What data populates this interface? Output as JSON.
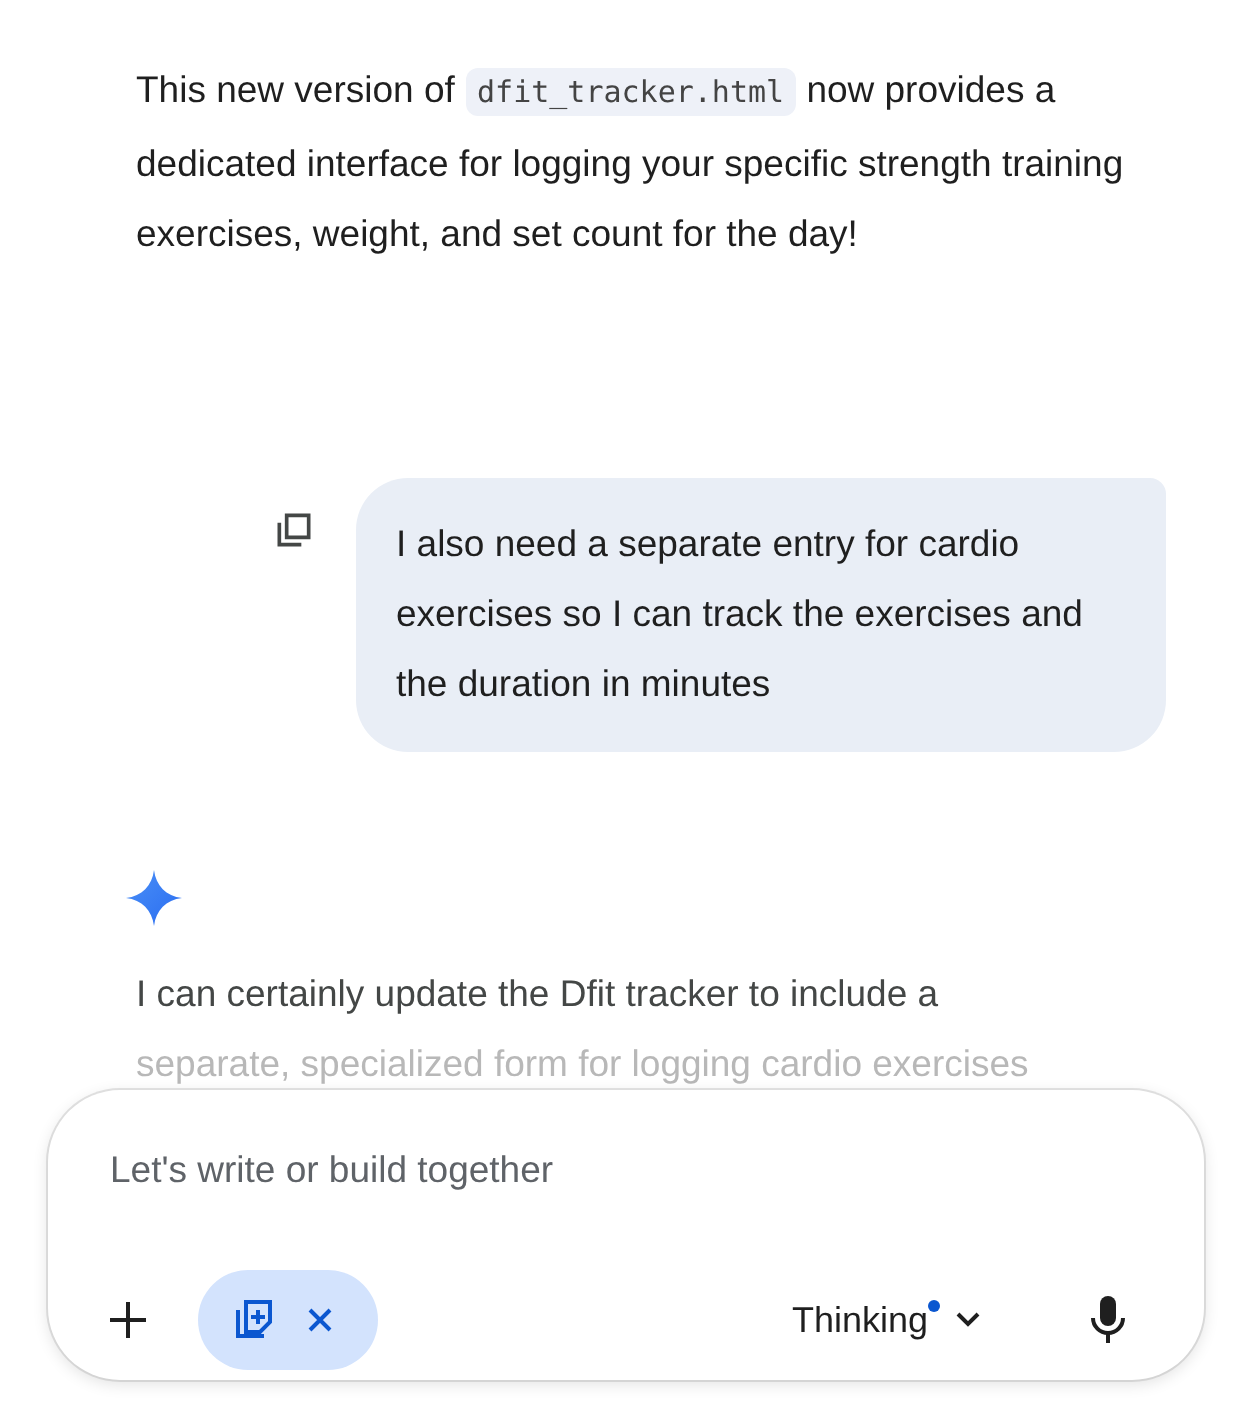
{
  "response_message": {
    "text_before": "This new version of",
    "code": "dfit_tracker.html",
    "text_after": "now provides a dedicated interface for logging your specific strength training exercises, weight, and set count for the day!"
  },
  "user_message": {
    "text": "I also need a separate entry for cardio exercises so I can track the exercises and the duration in minutes"
  },
  "reply": {
    "lines": [
      "I can certainly update the Dfit tracker to include a",
      "separate, specialized form for logging cardio exercises"
    ]
  },
  "composer": {
    "placeholder": "Let's write or build together",
    "mode": "Thinking",
    "mode_dot": true
  }
}
